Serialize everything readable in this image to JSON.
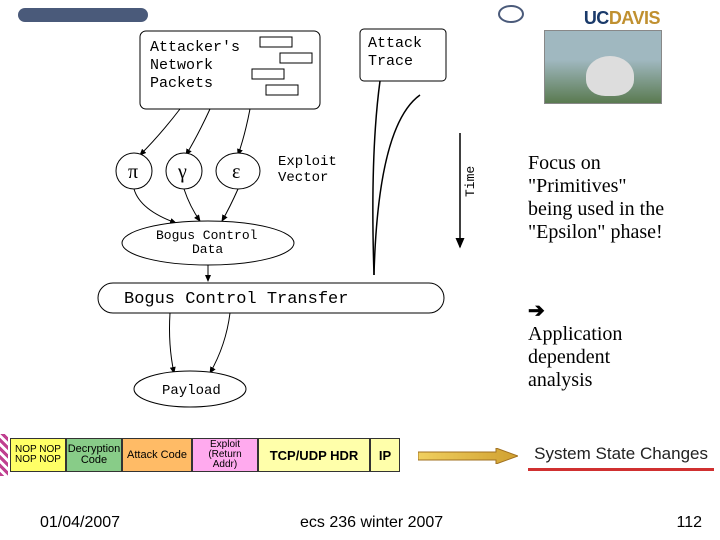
{
  "header": {
    "logo_uc": "UC",
    "logo_davis": "DAVIS"
  },
  "diagram": {
    "attacker_packets": "Attacker's\nNetwork\nPackets",
    "attack_trace": "Attack\nTrace",
    "exploit_vector": "Exploit\nVector",
    "pi": "π",
    "gamma": "γ",
    "epsilon": "ε",
    "bogus_control_data": "Bogus Control\nData",
    "bogus_control_transfer": "Bogus Control Transfer",
    "payload": "Payload",
    "time_label": "Time"
  },
  "notes": {
    "focus_line1": "Focus on",
    "focus_line2": "\"Primitives\"",
    "focus_line3": "being used in the",
    "focus_line4": "\"Epsilon\" phase!",
    "arrow": "➔",
    "app_line1": "Application",
    "app_line2": "dependent",
    "app_line3": "analysis"
  },
  "packet": {
    "nop": "NOP NOP\nNOP NOP",
    "decryption": "Decryption\nCode",
    "attack_code": "Attack Code",
    "exploit": "Exploit\n(Return Addr)",
    "tcpudp": "TCP/UDP HDR",
    "ip": "IP"
  },
  "state_changes": "System State Changes",
  "footer": {
    "date": "01/04/2007",
    "course": "ecs 236 winter 2007",
    "page": "112"
  }
}
